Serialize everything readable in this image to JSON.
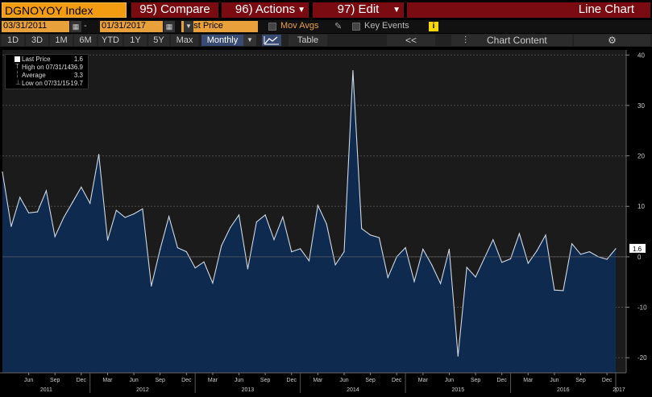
{
  "toolbar": {
    "ticker": "DGNOYOY Index",
    "compare": "95) Compare",
    "actions": "96) Actions",
    "edit": "97) Edit",
    "chart_title": "Line Chart"
  },
  "range": {
    "start": "03/31/2011",
    "end": "01/31/2017",
    "field": "Last Price",
    "mov_avgs": "Mov Avgs",
    "key_events": "Key Events",
    "info": "i"
  },
  "periods": [
    "1D",
    "3D",
    "1M",
    "6M",
    "YTD",
    "1Y",
    "5Y",
    "Max"
  ],
  "frequency": "Monthly",
  "table_label": "Table",
  "collapse_label": "<<",
  "chart_content_label": "Chart Content",
  "legend": {
    "last_label": "Last Price",
    "last_value": "1.6",
    "high_label": "High on 07/31/14",
    "high_value": "36.9",
    "avg_label": "Average",
    "avg_value": "3.3",
    "low_label": "Low on 07/31/15",
    "low_value": "-19.7"
  },
  "colors": {
    "accent": "#f39c12",
    "command": "#7a0b10",
    "area_fill": "#0f2a4f",
    "line": "#cfd8e3",
    "active_button": "#3a4b73"
  },
  "chart_data": {
    "type": "area",
    "title": "",
    "ylim": [
      -23,
      41
    ],
    "yticks": [
      -20,
      -10,
      0,
      10,
      20,
      30,
      40
    ],
    "last_value_label": "1.6",
    "x_tick_labels": [
      "Jun",
      "Sep",
      "Dec",
      "Mar",
      "Jun",
      "Sep",
      "Dec",
      "Mar",
      "Jun",
      "Sep",
      "Dec",
      "Mar",
      "Jun",
      "Sep",
      "Dec",
      "Mar",
      "Jun",
      "Sep",
      "Dec",
      "Mar",
      "Jun",
      "Sep",
      "Dec"
    ],
    "year_labels": [
      "2011",
      "2012",
      "2013",
      "2014",
      "2015",
      "2016",
      "2017"
    ],
    "series": [
      {
        "x": [
          "2011-03",
          "2011-04",
          "2011-05",
          "2011-06",
          "2011-07",
          "2011-08",
          "2011-09",
          "2011-10",
          "2011-11",
          "2011-12",
          "2012-01",
          "2012-02",
          "2012-03",
          "2012-04",
          "2012-05",
          "2012-06",
          "2012-07",
          "2012-08",
          "2012-09",
          "2012-10",
          "2012-11",
          "2012-12",
          "2013-01",
          "2013-02",
          "2013-03",
          "2013-04",
          "2013-05",
          "2013-06",
          "2013-07",
          "2013-08",
          "2013-09",
          "2013-10",
          "2013-11",
          "2013-12",
          "2014-01",
          "2014-02",
          "2014-03",
          "2014-04",
          "2014-05",
          "2014-06",
          "2014-07",
          "2014-08",
          "2014-09",
          "2014-10",
          "2014-11",
          "2014-12",
          "2015-01",
          "2015-02",
          "2015-03",
          "2015-04",
          "2015-05",
          "2015-06",
          "2015-07",
          "2015-08",
          "2015-09",
          "2015-10",
          "2015-11",
          "2015-12",
          "2016-01",
          "2016-02",
          "2016-03",
          "2016-04",
          "2016-05",
          "2016-06",
          "2016-07",
          "2016-08",
          "2016-09",
          "2016-10",
          "2016-11",
          "2016-12",
          "2017-01"
        ],
        "values": [
          16.8,
          6.0,
          11.8,
          8.7,
          8.9,
          13.1,
          4.0,
          7.8,
          10.8,
          13.8,
          10.6,
          20.3,
          3.3,
          9.2,
          7.8,
          8.5,
          9.5,
          -5.8,
          1.5,
          8.0,
          1.8,
          1.0,
          -2.2,
          -1.0,
          -5.2,
          2.2,
          5.8,
          8.3,
          -2.4,
          6.9,
          8.3,
          3.4,
          7.9,
          1.0,
          1.6,
          -0.8,
          10.2,
          6.5,
          -1.6,
          1.0,
          36.9,
          5.6,
          4.3,
          3.8,
          -4.1,
          0.0,
          1.8,
          -4.9,
          1.5,
          -1.6,
          -5.3,
          1.5,
          -19.7,
          -2.1,
          -4.0,
          -0.3,
          3.4,
          -1.1,
          -0.4,
          4.6,
          -1.3,
          1.2,
          4.3,
          -6.6,
          -6.7,
          2.6,
          0.5,
          1.0,
          0.0,
          -0.5,
          1.6
        ]
      }
    ]
  }
}
